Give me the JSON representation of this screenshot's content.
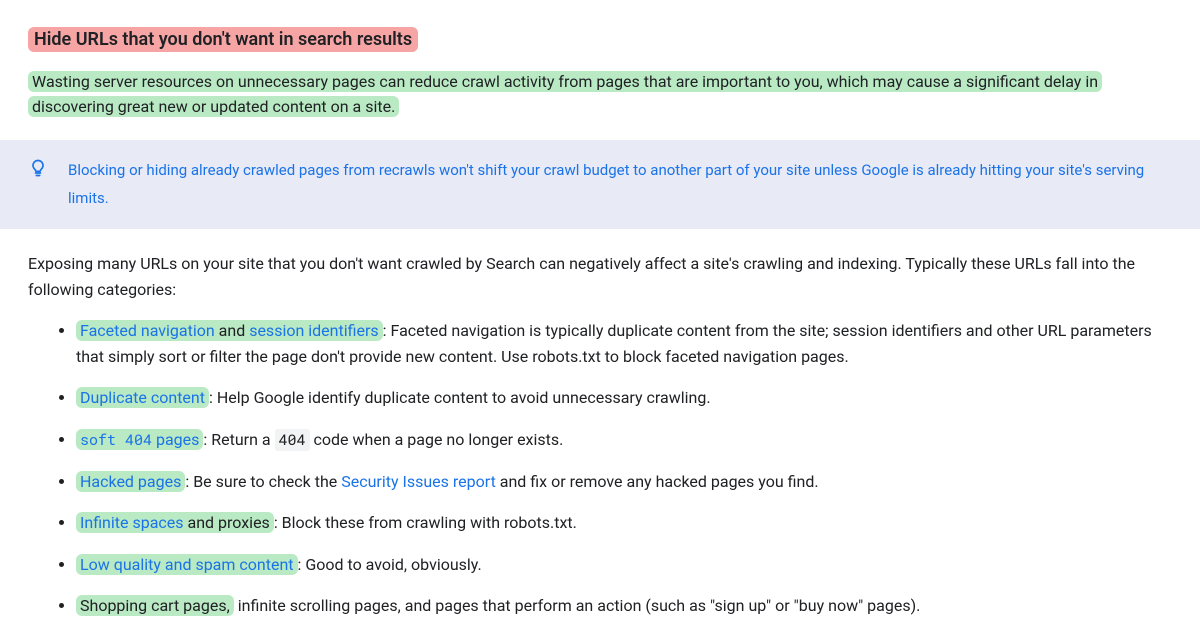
{
  "heading": "Hide URLs that you don't want in search results",
  "intro": "Wasting server resources on unnecessary pages can reduce crawl activity from pages that are important to you, which may cause a significant delay in discovering great new or updated content on a site.",
  "tip": "Blocking or hiding already crawled pages from recrawls won't shift your crawl budget to another part of your site unless Google is already hitting your site's serving limits.",
  "expose_intro": "Exposing many URLs on your site that you don't want crawled by Search can negatively affect a site's crawling and indexing. Typically these URLs fall into the following categories:",
  "items": {
    "faceted": {
      "link1": "Faceted navigation",
      "between": " and ",
      "link2": "session identifiers",
      "rest": ": Faceted navigation is typically duplicate content from the site; session identifiers and other URL parameters that simply sort or filter the page don't provide new content. Use robots.txt to block faceted navigation pages."
    },
    "duplicate": {
      "link": "Duplicate content",
      "rest": ": Help Google identify duplicate content to avoid unnecessary crawling."
    },
    "soft404": {
      "code1": "soft 404",
      "after_code1": " pages",
      "mid": ": Return a ",
      "code2": "404",
      "rest": " code when a page no longer exists."
    },
    "hacked": {
      "link": "Hacked pages",
      "mid": ": Be sure to check the ",
      "sec_link": "Security Issues report",
      "rest": " and fix or remove any hacked pages you find."
    },
    "infinite": {
      "link": "Infinite spaces",
      "after_link": " and proxies",
      "rest": ": Block these from crawling with robots.txt."
    },
    "lowq": {
      "link": "Low quality and spam content",
      "rest": ": Good to avoid, obviously."
    },
    "cart": {
      "hl": "Shopping cart pages,",
      "rest": " infinite scrolling pages, and pages that perform an action (such as \"sign up\" or \"buy now\" pages)."
    }
  }
}
